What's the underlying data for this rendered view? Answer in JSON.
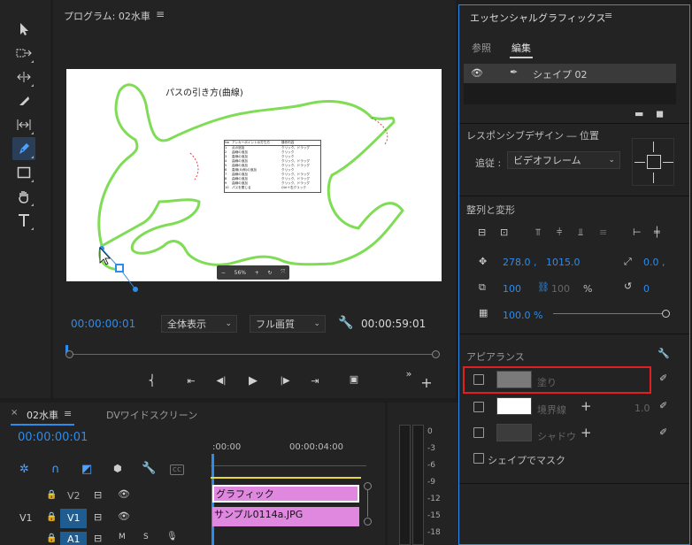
{
  "program_monitor": {
    "title": "プログラム: 02水車",
    "menu_icon": "hamburger-icon",
    "timecode_current": "00:00:00:01",
    "timecode_total": "00:00:59:01",
    "zoom_select": "全体表示",
    "quality_select": "フル画質",
    "preview": {
      "heading": "パスの引き方(曲線)",
      "zoom_percent": "56%",
      "table_header": [
        "No",
        "アンカーポイントの打ち方",
        "操作内容"
      ],
      "table_rows": [
        [
          "1",
          "点の追加",
          "クリック、ドラッグ"
        ],
        [
          "2",
          "曲線の追加",
          "クリック"
        ],
        [
          "3",
          "直線の追加",
          "クリック"
        ],
        [
          "4",
          "曲線の追加",
          "クリック、ドラッグ"
        ],
        [
          "5",
          "曲線の追加",
          "クリック、ドラッグ"
        ],
        [
          "6",
          "直線(片側)の追加",
          "クリック"
        ],
        [
          "7",
          "曲線の追加",
          "クリック、ドラッグ"
        ],
        [
          "8",
          "曲線の追加",
          "クリック、ドラッグ"
        ],
        [
          "9",
          "曲線の追加",
          "クリック、ドラッグ"
        ],
        [
          "10",
          "パスを閉じる",
          "Ctrl＋右クリック"
        ]
      ]
    }
  },
  "timeline": {
    "tab_active": "02水車",
    "tab_other": "DVワイドスクリーン",
    "timecode": "00:00:00:01",
    "ruler": [
      ":00:00",
      "00:00:04:00"
    ],
    "tracks": [
      {
        "label": "V2",
        "target": "V2",
        "clip": "グラフィック"
      },
      {
        "label": "V1",
        "target": "V1",
        "clip": "サンプル0114a.JPG"
      },
      {
        "label": "",
        "target": "A1",
        "clip": ""
      }
    ],
    "meter_labels": [
      "0",
      "-3",
      "-6",
      "-9",
      "-12",
      "-15",
      "-18"
    ]
  },
  "essential_graphics": {
    "title": "エッセンシャルグラフィックス",
    "tabs": [
      "参照",
      "編集"
    ],
    "active_tab": "編集",
    "layer_name": "シェイプ 02",
    "responsive_title": "レスポンシブデザイン ― 位置",
    "follow_label": "追従 :",
    "follow_value": "ビデオフレーム",
    "align_title": "整列と変形",
    "position_x": "278.0 ,",
    "position_y": "1015.0",
    "anchor_value": "0.0 ,",
    "scale_value": "100",
    "scale_linked": "100",
    "scale_unit": "%",
    "rotation_value": "0",
    "opacity_value": "100.0 %",
    "opacity_level": 1.0,
    "appearance_title": "アピアランス",
    "fill_label": "塗り",
    "stroke_label": "境界線",
    "stroke_width": "1.0",
    "shadow_label": "シャドウ",
    "mask_label": "シェイプでマスク",
    "colors": {
      "fill_swatch": "#7a7a7a",
      "stroke_swatch": "#ffffff",
      "shadow_swatch": "#3c3c3c",
      "highlight_box": "#e02020",
      "accent_blue": "#2d8ceb"
    }
  }
}
